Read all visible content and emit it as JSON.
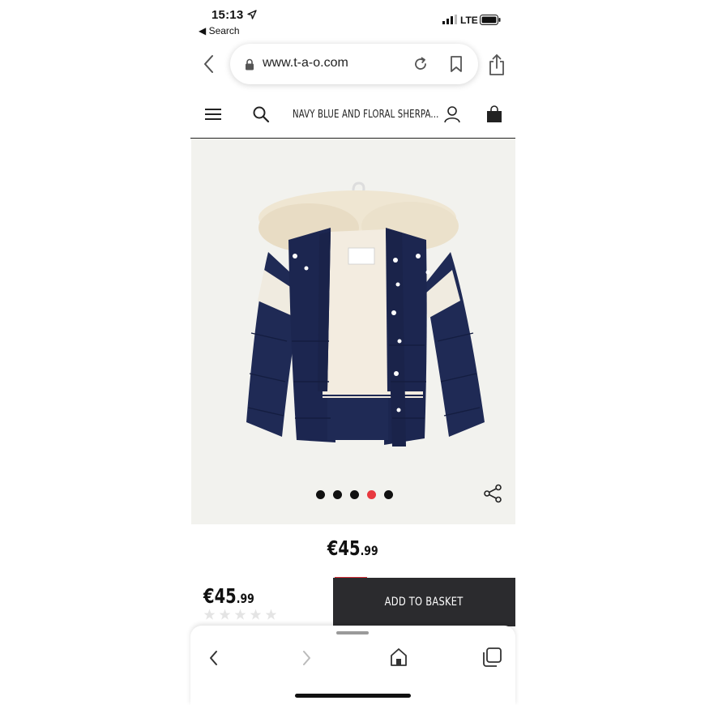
{
  "status_bar": {
    "time": "15:13",
    "back_app": "◀ Search",
    "carrier": "LTE"
  },
  "browser": {
    "url": "www.t-a-o.com"
  },
  "site_header": {
    "product_title": "NAVY BLUE AND FLORAL SHERPA..."
  },
  "gallery": {
    "image_count": 5,
    "active_index": 3,
    "dots": [
      "1",
      "2",
      "3",
      "4",
      "5"
    ],
    "active_color": "#e8393f"
  },
  "product": {
    "price_main": "€45",
    "price_cents": ".99",
    "rating_stars": 0,
    "rating_max": 5
  },
  "cta": {
    "add_to_basket": "ADD TO BASKET",
    "background": "#2b2b2e"
  },
  "icons": {
    "top": [
      "back-chevron-icon",
      "lock-icon",
      "reload-icon",
      "bookmark-icon",
      "share-icon"
    ],
    "header": [
      "menu-icon",
      "search-icon",
      "account-icon",
      "bag-icon"
    ],
    "toolbar": [
      "back-icon",
      "forward-icon",
      "home-icon",
      "tabs-icon"
    ]
  }
}
